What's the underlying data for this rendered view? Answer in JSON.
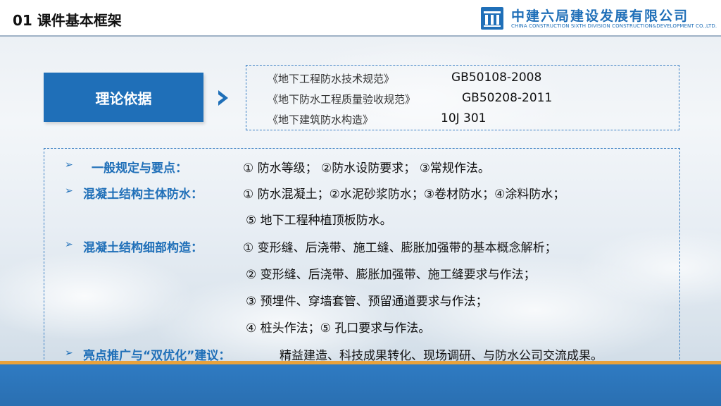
{
  "header": {
    "title": "01  课件基本框架",
    "logo_cn": "中建六局建设发展有限公司",
    "logo_en": "CHINA CONSTRUCTION SIXTH DIVISION CONSTRUCTION&DEVELOPMENT CO.,LTD."
  },
  "basis": {
    "label": "理论依据",
    "refs": [
      {
        "name": "《地下工程防水技术规范》",
        "code": "GB50108-2008"
      },
      {
        "name": "《地下防水工程质量验收规范》",
        "code": "GB50208-2011"
      },
      {
        "name": "《地下建筑防水构造》",
        "code": "10J 301"
      }
    ]
  },
  "sections": {
    "general": {
      "label": "一般规定与要点：",
      "lines": [
        "① 防水等级；     ②防水设防要求； ③常规作法。"
      ]
    },
    "concrete_main": {
      "label": "混凝土结构主体防水：",
      "lines": [
        "① 防水混凝土；②水泥砂浆防水；③卷材防水；④涂料防水；",
        "⑤ 地下工程种植顶板防水。"
      ]
    },
    "concrete_detail": {
      "label": "混凝土结构细部构造：",
      "lines": [
        "① 变形缝、后浇带、施工缝、膨胀加强带的基本概念解析；",
        "② 变形缝、后浇带、膨胀加强带、施工缝要求与作法；",
        "③ 预埋件、穿墙套管、预留通道要求与作法；",
        "④ 桩头作法；⑤ 孔口要求与作法。"
      ]
    },
    "highlight": {
      "label": "亮点推广与“双优化”建议：",
      "text": "精益建造、科技成果转化、现场调研、与防水公司交流成果。"
    }
  },
  "bullet_symbol": "➢",
  "colors": {
    "accent": "#1f6fb8",
    "footer": "#2f7cc4",
    "stripe": "#e9a23b"
  }
}
